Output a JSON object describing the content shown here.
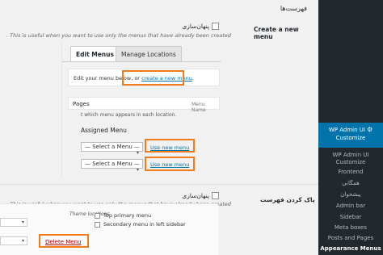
{
  "page": {
    "section_title": "فهرست‌ها"
  },
  "rows": [
    {
      "label": "Create a new menu",
      "checkbox_label": "پنهان‌سازی",
      "description": ". This is useful when you want to use only the menus that have already been created"
    },
    {
      "label": "پاک کردن فهرست",
      "checkbox_label": "پنهان‌سازی",
      "description": ". This is useful when you want to use only the menus that have already been created"
    }
  ],
  "screenshot": {
    "tabs": [
      "Edit Menus",
      "Manage Locations"
    ],
    "edit_text_prefix": "Edit your menu below, or",
    "edit_link": "create a new menu",
    "edit_text_suffix": ".",
    "pages_label": "Pages",
    "menu_name_label": "Menu Name",
    "location_text": "t which menu appears in each location.",
    "assigned_menu": "Assigned Menu",
    "select_placeholder": "— Select a Menu —",
    "use_new_menu": "Use new menu",
    "theme_locations": "Theme locations",
    "locations": [
      "Top primary menu",
      "Secondary menu in left sidebar"
    ],
    "delete_menu": "Delete Menu"
  },
  "sidebar": {
    "active_label_1": "WP Admin UI",
    "active_label_2": "Customize",
    "items": [
      "WP Admin UI Customize",
      "Frontend",
      "همگانی",
      "پیشخوان",
      "Admin bar",
      "Sidebar",
      "Meta boxes",
      "Posts and Pages",
      "Appearance Menus"
    ]
  },
  "colors": {
    "sidebar_bg": "#23282d",
    "active_bg": "#0073aa",
    "highlight": "#f07c1c",
    "link": "#0073aa",
    "delete": "#a00000"
  }
}
